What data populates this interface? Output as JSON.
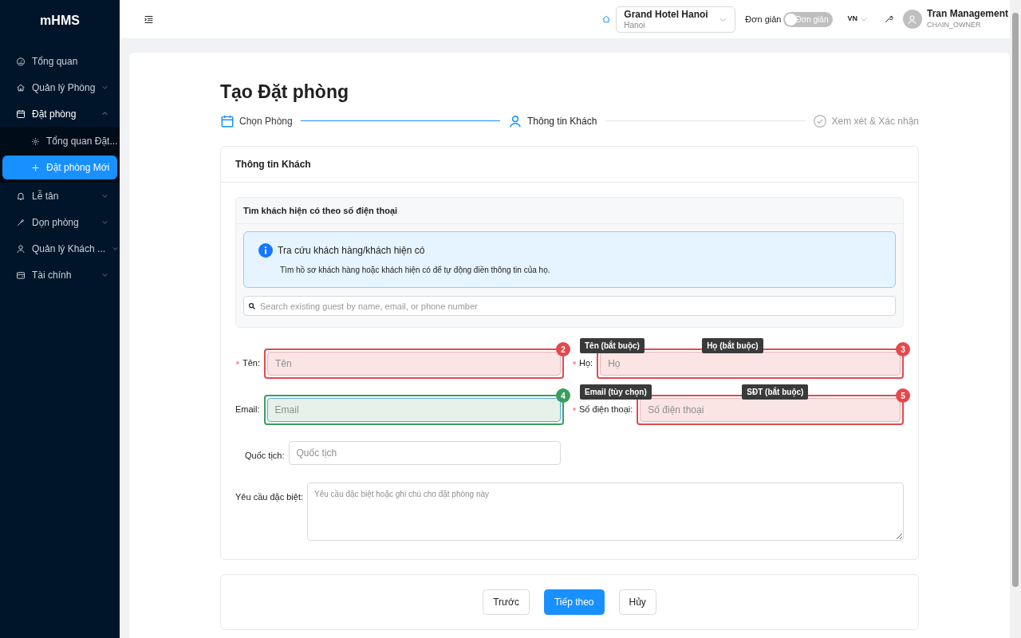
{
  "sidebar": {
    "brand": "mHMS",
    "items": [
      {
        "label": "Tổng quan",
        "kind": "link"
      },
      {
        "label": "Quản lý Phòng",
        "kind": "group",
        "expanded": false
      },
      {
        "label": "Đặt phòng",
        "kind": "group",
        "expanded": true,
        "children": [
          {
            "label": "Tổng quan Đặt...",
            "selected": false
          },
          {
            "label": "Đặt phòng Mới",
            "selected": true
          }
        ]
      },
      {
        "label": "Lễ tân",
        "kind": "group",
        "expanded": false
      },
      {
        "label": "Dọn phòng",
        "kind": "group",
        "expanded": false
      },
      {
        "label": "Quản lý Khách ...",
        "kind": "group",
        "expanded": false
      },
      {
        "label": "Tài chính",
        "kind": "group",
        "expanded": false
      }
    ]
  },
  "header": {
    "hotel": {
      "name": "Grand Hotel Hanoi",
      "city": "Hanoi"
    },
    "mode_label": "Đơn giản",
    "mode_toggle": {
      "label": "Đơn giản",
      "on": false
    },
    "language": "VN",
    "user": {
      "name": "Tran Management",
      "role": "CHAIN_OWNER"
    }
  },
  "page": {
    "title": "Tạo Đặt phòng",
    "steps": [
      {
        "label": "Chọn Phòng",
        "done": true,
        "selected": false
      },
      {
        "label": "Thông tin Khách",
        "done": false,
        "selected": true
      },
      {
        "label": "Xem xét & Xác nhận",
        "done": false,
        "selected": false
      }
    ]
  },
  "guest_card": {
    "title": "Thông tin Khách",
    "lookup": {
      "title": "Tìm khách hiện có theo số điện thoại",
      "alert_title": "Tra cứu khách hàng/khách hiện có",
      "alert_text": "Tìm hồ sơ khách hàng hoặc khách hiện có để tự động điền thông tin của họ.",
      "search_placeholder": "Search existing guest by name, email, or phone number"
    },
    "fields": [
      {
        "label": "Tên:",
        "required": true,
        "placeholder": "Tên",
        "kind": "input",
        "annotation": {
          "number": "2",
          "note": "Tên (bắt buộc)",
          "color": "#e5484d"
        }
      },
      {
        "label": "Họ:",
        "required": true,
        "placeholder": "Họ",
        "kind": "input",
        "annotation": {
          "number": "3",
          "note": "Họ (bắt buộc)",
          "color": "#e5484d"
        }
      },
      {
        "label": "Email:",
        "required": false,
        "placeholder": "Email",
        "kind": "input",
        "annotation": {
          "number": "4",
          "note": "Email (tùy chọn)",
          "color": "#3a9e5f"
        }
      },
      {
        "label": "Số điện thoại:",
        "required": true,
        "placeholder": "Số điện thoại",
        "kind": "input",
        "annotation": {
          "number": "5",
          "note": "SĐT (bắt buộc)",
          "color": "#e5484d"
        }
      },
      {
        "label": "Quốc tịch:",
        "required": false,
        "placeholder": "Quốc tịch",
        "kind": "input"
      },
      {
        "label": "Yêu cầu đặc biệt:",
        "required": false,
        "placeholder": "Yêu cầu đặc biệt hoặc ghi chú cho đặt phòng này",
        "kind": "textarea"
      }
    ]
  },
  "actions": [
    {
      "label": "Trước",
      "kind": "default"
    },
    {
      "label": "Tiếp theo",
      "kind": "primary"
    },
    {
      "label": "Hủy",
      "kind": "default"
    }
  ]
}
